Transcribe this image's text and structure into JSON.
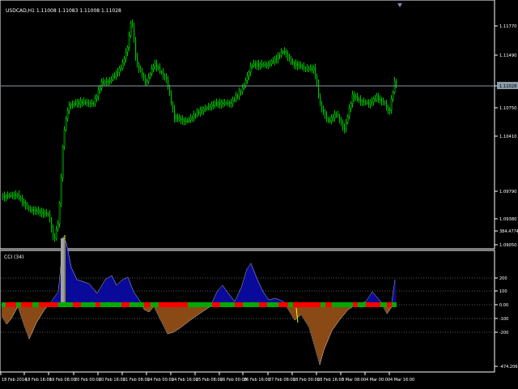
{
  "main_chart": {
    "title": "USDCAD,H1  1.11008 1.11083 1.11008 1.11028",
    "price_labels": [
      "1.11770",
      "1.11490",
      "1.11028",
      "1.10750",
      "1.10410",
      "1.09790",
      "1.09380",
      "1.09050"
    ],
    "current_price": "1.11028",
    "colors": {
      "bull": "#00c000",
      "bear": "#ffffff",
      "current_line": "#8a9aa8",
      "axis": "#ffffff",
      "background": "#000000"
    }
  },
  "indicator": {
    "title": "CCI (34)",
    "levels": [
      "384.4774",
      "200",
      "100",
      "0.00",
      "-100",
      "-200",
      "-474.2068"
    ],
    "colors": {
      "positive": "#0a0a9a",
      "negative": "#8a4b16",
      "above_100": "#00aa00",
      "below": "#ff0000",
      "grid": "#777777",
      "extreme_line": "#a0a0a0",
      "yellow": "#ffff00"
    }
  },
  "time_axis": {
    "labels": [
      "18 Feb 2014",
      "18 Feb 16:00",
      "19 Feb 08:00",
      "20 Feb 00:00",
      "20 Feb 16:00",
      "21 Feb 08:00",
      "24 Feb 00:00",
      "24 Feb 16:00",
      "25 Feb 08:00",
      "26 Feb 00:00",
      "26 Feb 16:00",
      "27 Feb 08:00",
      "28 Feb 00:00",
      "28 Feb 16:00",
      "3 Mar 08:00",
      "4 Mar 00:00",
      "4 Mar 16:00"
    ]
  },
  "scroll_marker": "shift-arrow-icon"
}
